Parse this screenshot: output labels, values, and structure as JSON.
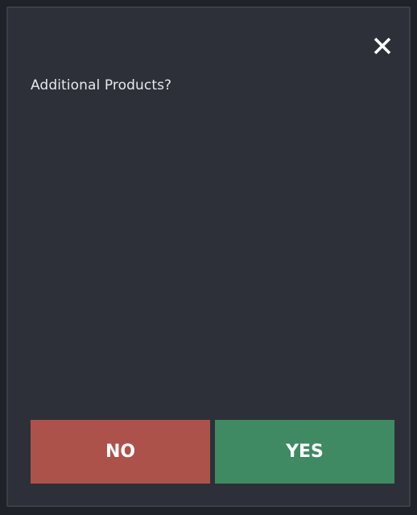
{
  "dialog": {
    "title": "Additional Products?",
    "close_icon": "close-icon",
    "buttons": {
      "no_label": "NO",
      "yes_label": "YES"
    }
  },
  "colors": {
    "background": "#1f2229",
    "dialog_bg": "#2d3038",
    "no_button": "#ad524b",
    "yes_button": "#3f8a63",
    "text": "#e6e8ec"
  }
}
